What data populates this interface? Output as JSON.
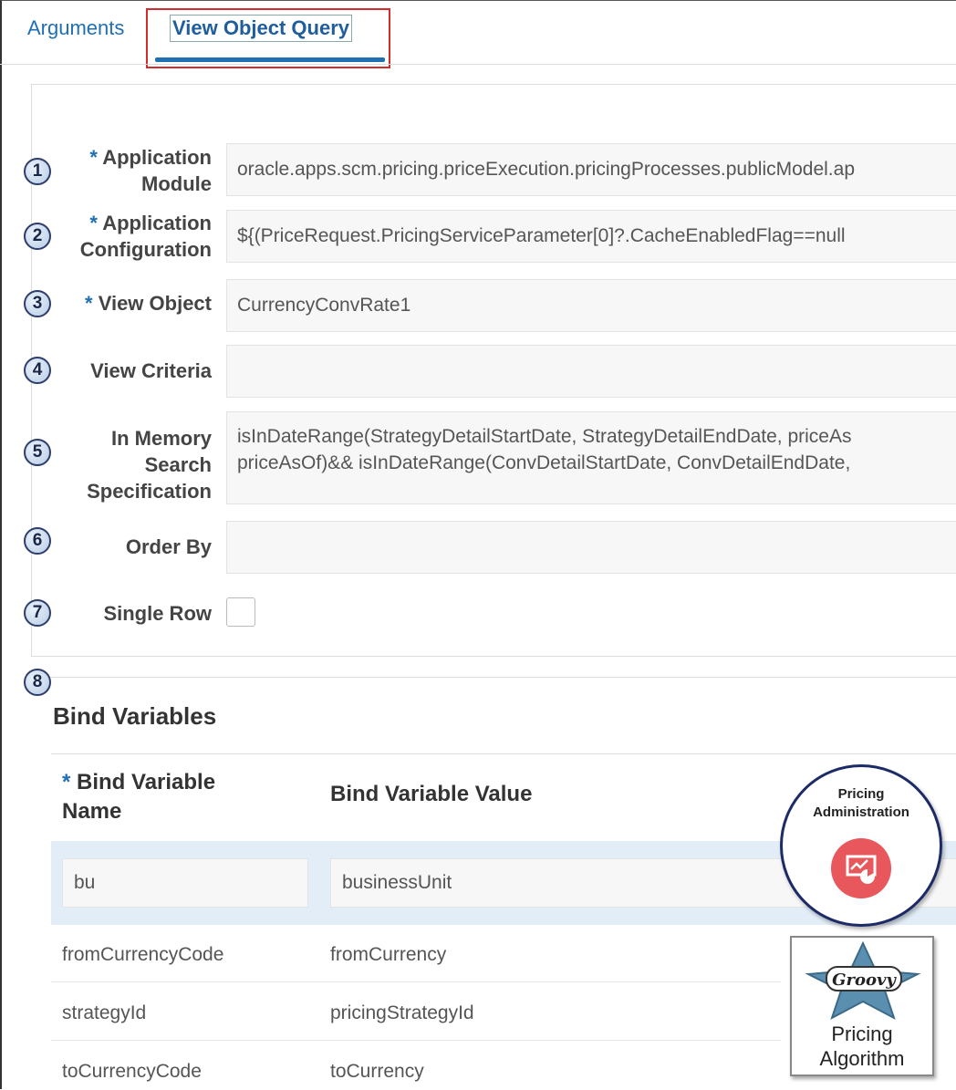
{
  "tabs": {
    "arguments": "Arguments",
    "view_object_query": "View Object Query"
  },
  "callouts": [
    "1",
    "2",
    "3",
    "4",
    "5",
    "6",
    "7",
    "8"
  ],
  "form": {
    "required_mark": "*",
    "app_module": {
      "label_line1": "Application",
      "label_line2": "Module",
      "value": "oracle.apps.scm.pricing.priceExecution.pricingProcesses.publicModel.ap"
    },
    "app_config": {
      "label_line1": "Application",
      "label_line2": "Configuration",
      "value": "${(PriceRequest.PricingServiceParameter[0]?.CacheEnabledFlag==null"
    },
    "view_object": {
      "label": "View Object",
      "value": "CurrencyConvRate1"
    },
    "view_criteria": {
      "label": "View Criteria",
      "value": ""
    },
    "in_memory": {
      "label_line1": "In Memory",
      "label_line2": "Search",
      "label_line3": "Specification",
      "value_line1": "isInDateRange(StrategyDetailStartDate, StrategyDetailEndDate, priceAs",
      "value_line2": "priceAsOf)&& isInDateRange(ConvDetailStartDate, ConvDetailEndDate,"
    },
    "order_by": {
      "label": "Order By",
      "value": ""
    },
    "single_row": {
      "label": "Single Row",
      "checked": false
    }
  },
  "bind_variables": {
    "title": "Bind Variables",
    "col_name_line1": "Bind Variable",
    "col_name_line2": "Name",
    "col_value": "Bind Variable Value",
    "rows": [
      {
        "name": "bu",
        "value": "businessUnit"
      },
      {
        "name": "fromCurrencyCode",
        "value": "fromCurrency"
      },
      {
        "name": "strategyId",
        "value": "pricingStrategyId"
      },
      {
        "name": "toCurrencyCode",
        "value": "toCurrency"
      }
    ]
  },
  "badges": {
    "admin_line1": "Pricing",
    "admin_line2": "Administration",
    "groovy_logo_text": "Groovy",
    "algorithm_line1": "Pricing",
    "algorithm_line2": "Algorithm"
  },
  "colors": {
    "accent": "#1f6fb2",
    "highlight": "#d42c2c",
    "selected_row": "#e2edf8",
    "admin_icon": "#e8575c"
  }
}
